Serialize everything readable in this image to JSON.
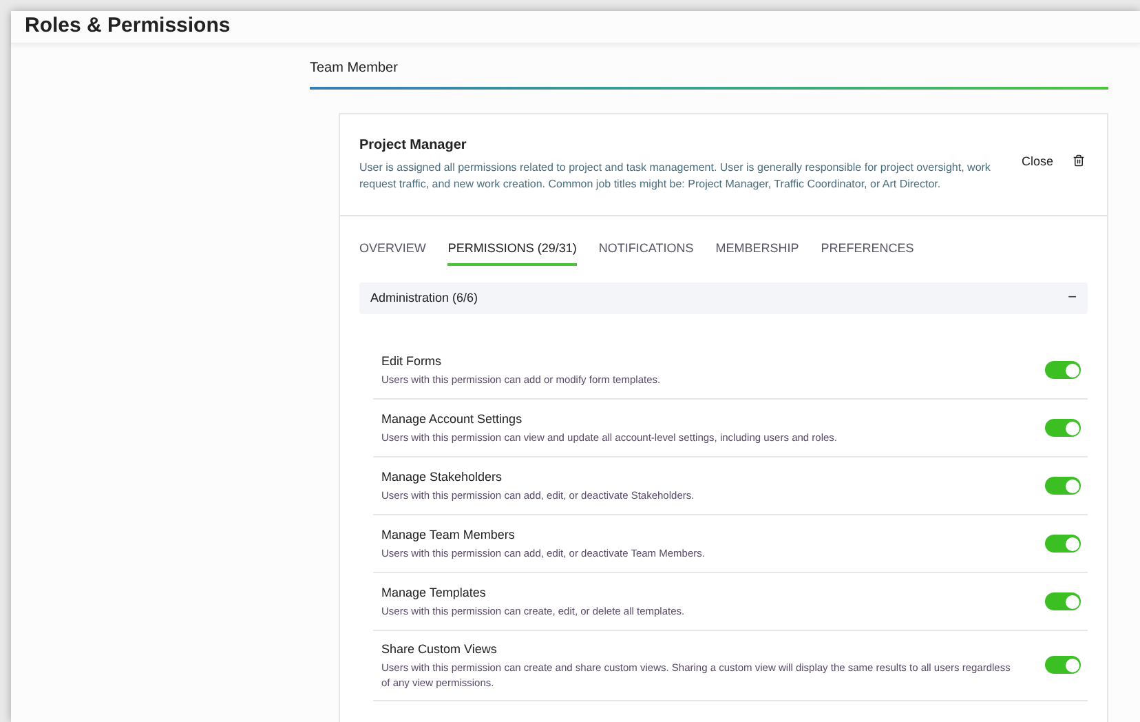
{
  "header": {
    "title": "Roles & Permissions"
  },
  "section_tab": {
    "label": "Team Member"
  },
  "role": {
    "name": "Project Manager",
    "description": "User is assigned all permissions related to project and task management. User is generally responsible for project oversight, work request traffic, and new work creation. Common job titles might be: Project Manager, Traffic Coordinator, or Art Director.",
    "close_label": "Close"
  },
  "tabs": [
    {
      "label": "OVERVIEW",
      "selected": false
    },
    {
      "label": "PERMISSIONS (29/31)",
      "selected": true
    },
    {
      "label": "NOTIFICATIONS",
      "selected": false
    },
    {
      "label": "MEMBERSHIP",
      "selected": false
    },
    {
      "label": "PREFERENCES",
      "selected": false
    }
  ],
  "group": {
    "title": "Administration (6/6)",
    "expanded": true,
    "toggle_symbol": "−"
  },
  "permissions": [
    {
      "name": "Edit Forms",
      "description": "Users with this permission can add or modify form templates.",
      "on": true
    },
    {
      "name": "Manage Account Settings",
      "description": "Users with this permission can view and update all account-level settings, including users and roles.",
      "on": true
    },
    {
      "name": "Manage Stakeholders",
      "description": "Users with this permission can add, edit, or deactivate Stakeholders.",
      "on": true
    },
    {
      "name": "Manage Team Members",
      "description": "Users with this permission can add, edit, or deactivate Team Members.",
      "on": true
    },
    {
      "name": "Manage Templates",
      "description": "Users with this permission can create, edit, or delete all templates.",
      "on": true
    },
    {
      "name": "Share Custom Views",
      "description": "Users with this permission can create and share custom views. Sharing a custom view will display the same results to all users regardless of any view permissions.",
      "on": true
    }
  ]
}
